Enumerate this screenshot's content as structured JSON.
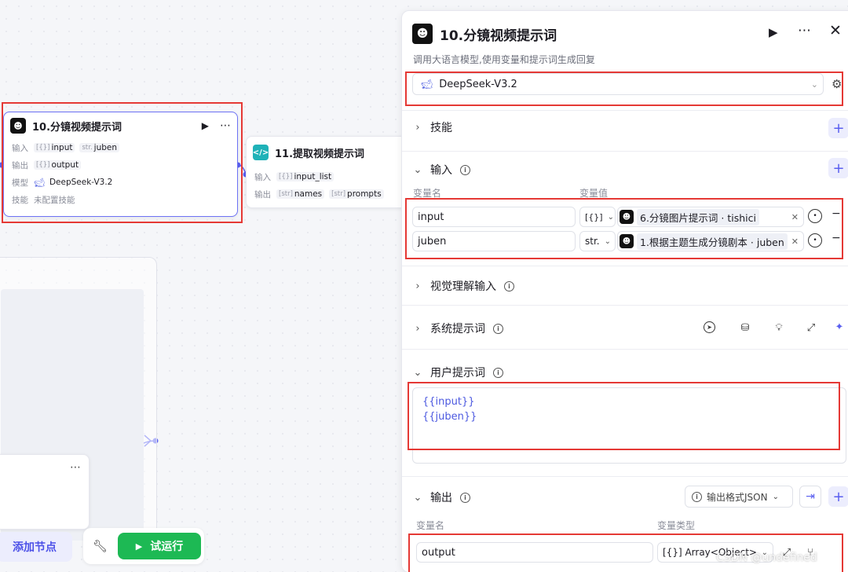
{
  "canvas": {
    "node10": {
      "title": "10.分镜视频提示词",
      "in_label": "输入",
      "out_label": "输出",
      "model_label": "模型",
      "skill_label": "技能",
      "inputs": [
        {
          "type": "[{}]",
          "name": "input"
        },
        {
          "type": "str.",
          "name": "juben"
        }
      ],
      "output": {
        "type": "[{}]",
        "name": "output"
      },
      "model": "DeepSeek-V3.2",
      "skill": "未配置技能"
    },
    "node11": {
      "title": "11.提取视频提示词",
      "in_label": "输入",
      "out_label": "输出",
      "input": {
        "type": "[{}]",
        "name": "input_list"
      },
      "outputs": [
        {
          "type": "[str]",
          "name": "names"
        },
        {
          "type": "[str]",
          "name": "prompts"
        }
      ]
    },
    "add_node_label": "添加节点",
    "run_label": "试运行"
  },
  "panel": {
    "title": "10.分镜视频提示词",
    "description": "调用大语言模型,使用变量和提示词生成回复",
    "model": "DeepSeek-V3.2",
    "sections": {
      "skills": "技能",
      "inputs": "输入",
      "vision": "视觉理解输入",
      "system_prompt": "系统提示词",
      "user_prompt": "用户提示词",
      "output": "输出"
    },
    "input_headers": {
      "name": "变量名",
      "value": "变量值"
    },
    "inputs": [
      {
        "name": "input",
        "type": "[{}]",
        "ref": "6.分镜图片提示词 · tishici"
      },
      {
        "name": "juben",
        "type": "str.",
        "ref": "1.根据主题生成分镜剧本 · juben"
      }
    ],
    "user_prompt_lines": [
      "{{input}}",
      "{{juben}}"
    ],
    "output_format": "输出格式JSON",
    "output_headers": {
      "name": "变量名",
      "type": "变量类型"
    },
    "outputs": [
      {
        "name": "output",
        "type": "[{}] Array<Object>"
      }
    ]
  },
  "watermark": "CSDN @undefined",
  "colors": {
    "accent": "#5a5ff0",
    "run_green": "#1db954",
    "highlight_red": "#e53935"
  }
}
